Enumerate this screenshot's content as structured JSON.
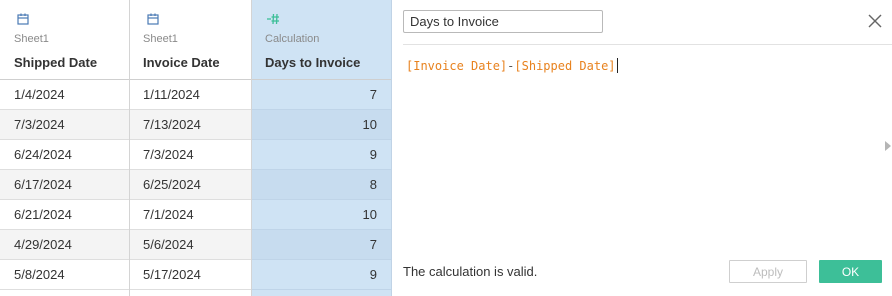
{
  "columns": [
    {
      "source": "Sheet1",
      "field": "Shipped Date",
      "type_icon": "calendar-icon"
    },
    {
      "source": "Sheet1",
      "field": "Invoice Date",
      "type_icon": "calendar-icon"
    },
    {
      "source": "Calculation",
      "field": "Days to Invoice",
      "type_icon": "calculated-field-icon"
    }
  ],
  "rows": [
    [
      "1/4/2024",
      "1/11/2024",
      "7"
    ],
    [
      "7/3/2024",
      "7/13/2024",
      "10"
    ],
    [
      "6/24/2024",
      "7/3/2024",
      "9"
    ],
    [
      "6/17/2024",
      "6/25/2024",
      "8"
    ],
    [
      "6/21/2024",
      "7/1/2024",
      "10"
    ],
    [
      "4/29/2024",
      "5/6/2024",
      "7"
    ],
    [
      "5/8/2024",
      "5/17/2024",
      "9"
    ]
  ],
  "editor": {
    "name": "Days to Invoice",
    "formula_field_1": "[Invoice Date]",
    "formula_operator": "-",
    "formula_field_2": "[Shipped Date]",
    "status": "The calculation is valid.",
    "apply_label": "Apply",
    "ok_label": "OK"
  },
  "colors": {
    "calc_column_bg": "#cfe3f4",
    "field_reference": "#e8821e",
    "ok_button": "#3dbf98",
    "calc_icon": "#3dbf98",
    "date_icon": "#4a7ab5"
  }
}
